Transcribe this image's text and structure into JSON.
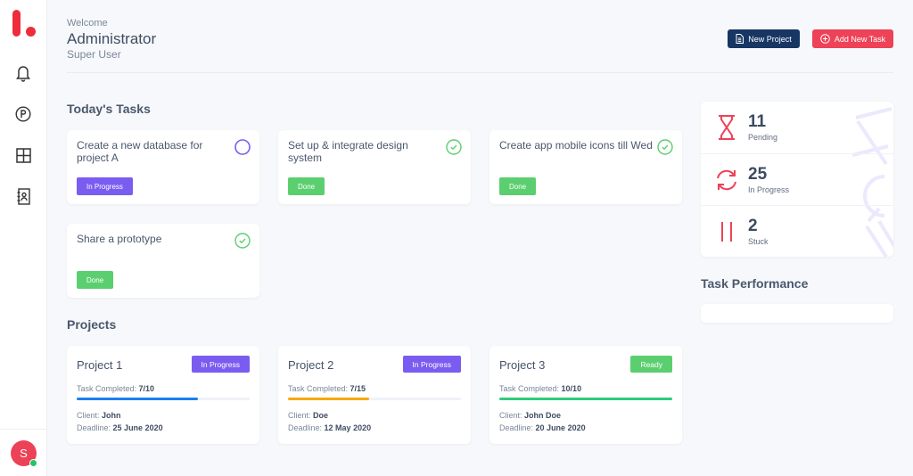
{
  "sidebar": {
    "logo": "logo",
    "nav": [
      {
        "name": "notifications",
        "icon": "bell-icon"
      },
      {
        "name": "parking",
        "icon": "parking-icon"
      },
      {
        "name": "dashboard",
        "icon": "grid-icon"
      },
      {
        "name": "contacts",
        "icon": "contact-book-icon"
      }
    ],
    "avatar": {
      "initial": "S",
      "status": "online",
      "status_color": "#22c36b"
    }
  },
  "header": {
    "welcome": "Welcome",
    "user_name": "Administrator",
    "user_role": "Super User",
    "new_project_label": "New Project",
    "add_task_label": "Add New Task"
  },
  "tasks_section": {
    "title": "Today's Tasks",
    "tasks": [
      {
        "title": "Create a new database for project A",
        "status": "In Progress",
        "completed": false
      },
      {
        "title": "Set up & integrate design system",
        "status": "Done",
        "completed": true
      },
      {
        "title": "Create app mobile icons till Wed",
        "status": "Done",
        "completed": true
      },
      {
        "title": "Share a prototype",
        "status": "Done",
        "completed": true
      }
    ]
  },
  "projects_section": {
    "title": "Projects",
    "completed_label": "Task Completed:",
    "client_label": "Client:",
    "deadline_label": "Deadline:",
    "projects": [
      {
        "name": "Project 1",
        "status": "In Progress",
        "completed": "7/10",
        "progress": 0.7,
        "bar_color": "#1a7ff0",
        "client": "John",
        "deadline": "25 June 2020"
      },
      {
        "name": "Project 2",
        "status": "In Progress",
        "completed": "7/15",
        "progress": 0.4667,
        "bar_color": "#f7a90b",
        "client": "Doe",
        "deadline": "12 May 2020"
      },
      {
        "name": "Project 3",
        "status": "Ready",
        "completed": "10/10",
        "progress": 1.0,
        "bar_color": "#2ecc7a",
        "client": "John Doe",
        "deadline": "20 June 2020"
      }
    ]
  },
  "stats": [
    {
      "value": "11",
      "label": "Pending",
      "icon": "hourglass-icon"
    },
    {
      "value": "25",
      "label": "In Progress",
      "icon": "refresh-icon"
    },
    {
      "value": "2",
      "label": "Stuck",
      "icon": "pause-icon"
    }
  ],
  "performance": {
    "title": "Task Performance"
  },
  "colors": {
    "accent_red": "#ee4258",
    "navy": "#173663",
    "purple": "#7a5cf0",
    "green": "#5bcf6f"
  }
}
